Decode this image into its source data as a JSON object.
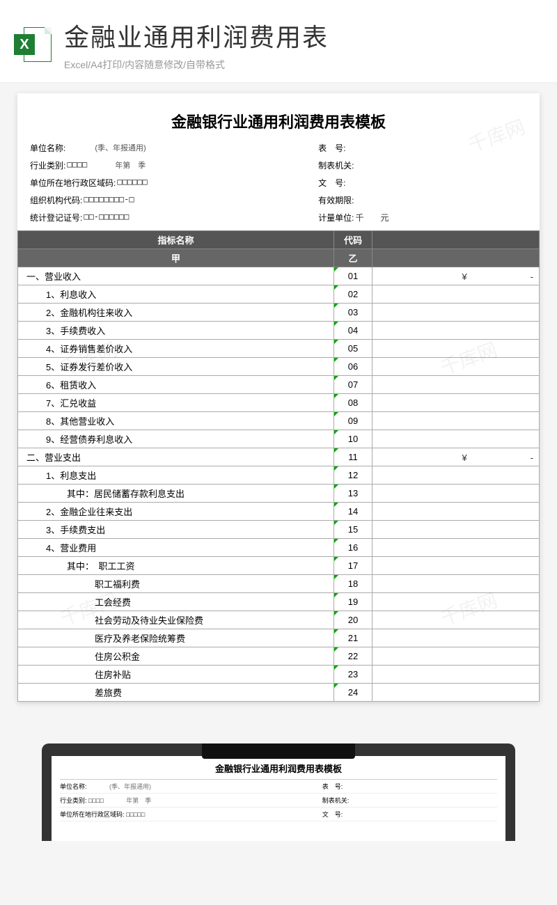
{
  "header": {
    "title": "金融业通用利润费用表",
    "subtitle": "Excel/A4打印/内容随意修改/自带格式",
    "icon_letter": "X"
  },
  "watermark": "千库网",
  "doc": {
    "title": "金融银行业通用利润费用表模板",
    "meta": [
      {
        "left_label": "单位名称:",
        "left_val": "",
        "note": "(季、年报通用)",
        "right_label": "表　号:",
        "right_val": ""
      },
      {
        "left_label": "行业类别:",
        "left_val": "□□□□",
        "note": "年第　季",
        "right_label": "制表机关:",
        "right_val": ""
      },
      {
        "left_label": "单位所在地行政区域码:",
        "left_val": "□□□□□□",
        "note": "",
        "right_label": "文　号:",
        "right_val": ""
      },
      {
        "left_label": "组织机构代码:",
        "left_val": "□□□□□□□□-□",
        "note": "",
        "right_label": "有效期限:",
        "right_val": ""
      },
      {
        "left_label": "统计登记证号:",
        "left_val": "□□-□□□□□□",
        "note": "",
        "right_label": "计量单位:",
        "right_val": "千　　元"
      }
    ],
    "columns": {
      "name": "指标名称",
      "name_sub": "甲",
      "code": "代码",
      "code_sub": "乙"
    },
    "rows": [
      {
        "name": "一、营业收入",
        "code": "01",
        "val": "¥　　　　　　　-",
        "indent": 0
      },
      {
        "name": "1、利息收入",
        "code": "02",
        "val": "",
        "indent": 1
      },
      {
        "name": "2、金融机构往来收入",
        "code": "03",
        "val": "",
        "indent": 1
      },
      {
        "name": "3、手续费收入",
        "code": "04",
        "val": "",
        "indent": 1
      },
      {
        "name": "4、证券销售差价收入",
        "code": "05",
        "val": "",
        "indent": 1
      },
      {
        "name": "5、证券发行差价收入",
        "code": "06",
        "val": "",
        "indent": 1
      },
      {
        "name": "6、租赁收入",
        "code": "07",
        "val": "",
        "indent": 1
      },
      {
        "name": "7、汇兑收益",
        "code": "08",
        "val": "",
        "indent": 1
      },
      {
        "name": "8、其他营业收入",
        "code": "09",
        "val": "",
        "indent": 1
      },
      {
        "name": "9、经营债券利息收入",
        "code": "10",
        "val": "",
        "indent": 1
      },
      {
        "name": "二、营业支出",
        "code": "11",
        "val": "¥　　　　　　　-",
        "indent": 0
      },
      {
        "name": "1、利息支出",
        "code": "12",
        "val": "",
        "indent": 1
      },
      {
        "name": "其中：居民储蓄存款利息支出",
        "code": "13",
        "val": "",
        "indent": 2
      },
      {
        "name": "2、金融企业往来支出",
        "code": "14",
        "val": "",
        "indent": 1
      },
      {
        "name": "3、手续费支出",
        "code": "15",
        "val": "",
        "indent": 1
      },
      {
        "name": "4、营业费用",
        "code": "16",
        "val": "",
        "indent": 1
      },
      {
        "name": "其中：　职工工资",
        "code": "17",
        "val": "",
        "indent": 2
      },
      {
        "name": "职工福利费",
        "code": "18",
        "val": "",
        "indent": 3
      },
      {
        "name": "工会经费",
        "code": "19",
        "val": "",
        "indent": 3
      },
      {
        "name": "社会劳动及待业失业保险费",
        "code": "20",
        "val": "",
        "indent": 3
      },
      {
        "name": "医疗及养老保险统筹费",
        "code": "21",
        "val": "",
        "indent": 3
      },
      {
        "name": "住房公积金",
        "code": "22",
        "val": "",
        "indent": 3
      },
      {
        "name": "住房补贴",
        "code": "23",
        "val": "",
        "indent": 3
      },
      {
        "name": "差旅费",
        "code": "24",
        "val": "",
        "indent": 3
      }
    ]
  },
  "preview": {
    "title": "金融银行业通用利润费用表模板",
    "rows": [
      {
        "l": "单位名称:",
        "n": "(季、年报通用)",
        "r": "表　号:"
      },
      {
        "l": "行业类别: □□□□",
        "n": "年第　季",
        "r": "制表机关:"
      },
      {
        "l": "单位所在地行政区域码: □□□□□",
        "n": "",
        "r": "文　号:"
      }
    ]
  }
}
